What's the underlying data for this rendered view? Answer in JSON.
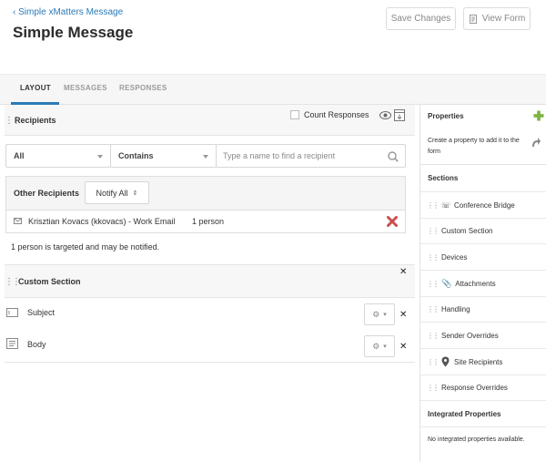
{
  "header": {
    "breadcrumb": "Simple xMatters Message",
    "title": "Simple Message",
    "save_label": "Save Changes",
    "view_label": "View Form"
  },
  "tabs": [
    {
      "label": "LAYOUT",
      "active": true
    },
    {
      "label": "MESSAGES",
      "active": false
    },
    {
      "label": "RESPONSES",
      "active": false
    }
  ],
  "recipients": {
    "title": "Recipients",
    "count_responses": "Count Responses",
    "filter_value": "All",
    "operator_value": "Contains",
    "search_placeholder": "Type a name to find a recipient",
    "other_recipients_label": "Other Recipients",
    "notify_value": "Notify All",
    "recipient_entry": "Krisztian Kovacs (kkovacs) - Work Email",
    "recipient_count": "1 person",
    "target_note": "1 person is targeted and may be notified."
  },
  "custom_section": {
    "title": "Custom Section",
    "fields": [
      {
        "label": "Subject"
      },
      {
        "label": "Body"
      }
    ]
  },
  "sidebar": {
    "properties_title": "Properties",
    "properties_hint": "Create a property to add it to the form",
    "sections_title": "Sections",
    "sections": [
      {
        "label": "Conference Bridge",
        "icon": "phone-icon"
      },
      {
        "label": "Custom Section",
        "icon": ""
      },
      {
        "label": "Devices",
        "icon": ""
      },
      {
        "label": "Attachments",
        "icon": "paperclip-icon"
      },
      {
        "label": "Handling",
        "icon": ""
      },
      {
        "label": "Sender Overrides",
        "icon": ""
      },
      {
        "label": "Site Recipients",
        "icon": "location-pin-icon"
      },
      {
        "label": "Response Overrides",
        "icon": ""
      }
    ],
    "integrated_title": "Integrated Properties",
    "integrated_empty": "No integrated properties available."
  },
  "colors": {
    "accent": "#2a7ab8",
    "add_green": "#7cb342",
    "remove_red": "#c9504d"
  }
}
